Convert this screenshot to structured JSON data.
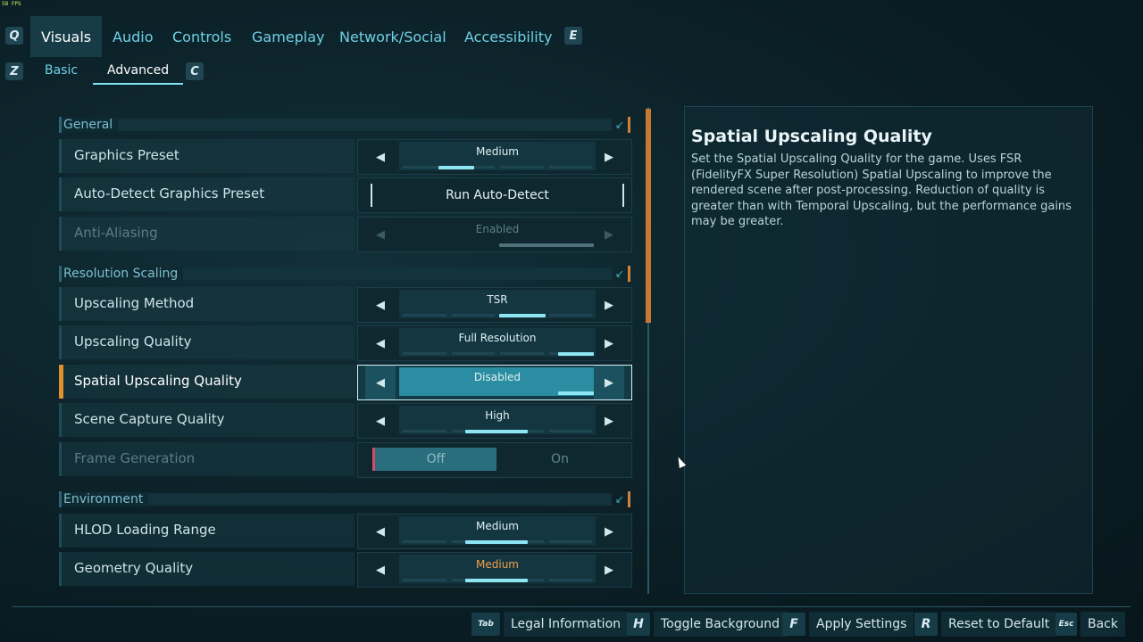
{
  "fps": "58 FPS",
  "nav": {
    "left_key": "Q",
    "right_key": "E",
    "tabs": [
      {
        "label": "Visuals",
        "active": true
      },
      {
        "label": "Audio"
      },
      {
        "label": "Controls"
      },
      {
        "label": "Gameplay"
      },
      {
        "label": "Network/Social"
      },
      {
        "label": "Accessibility"
      }
    ]
  },
  "subnav": {
    "left_key": "Z",
    "right_key": "C",
    "tabs": [
      {
        "label": "Basic"
      },
      {
        "label": "Advanced",
        "active": true
      }
    ]
  },
  "sections": {
    "general": "General",
    "resolution_scaling": "Resolution Scaling",
    "environment": "Environment"
  },
  "settings": {
    "graphics_preset": {
      "label": "Graphics Preset",
      "value": "Medium"
    },
    "auto_detect": {
      "label": "Auto-Detect Graphics Preset",
      "button": "Run Auto-Detect"
    },
    "anti_aliasing": {
      "label": "Anti-Aliasing",
      "value": "Enabled"
    },
    "upscaling_method": {
      "label": "Upscaling Method",
      "value": "TSR"
    },
    "upscaling_quality": {
      "label": "Upscaling Quality",
      "value": "Full Resolution"
    },
    "spatial_upscaling_quality": {
      "label": "Spatial Upscaling Quality",
      "value": "Disabled"
    },
    "scene_capture_quality": {
      "label": "Scene Capture Quality",
      "value": "High"
    },
    "frame_generation": {
      "label": "Frame Generation",
      "off": "Off",
      "on": "On"
    },
    "hlod_loading_range": {
      "label": "HLOD Loading Range",
      "value": "Medium"
    },
    "geometry_quality": {
      "label": "Geometry Quality",
      "value": "Medium"
    }
  },
  "description": {
    "title": "Spatial Upscaling Quality",
    "text": "Set the Spatial Upscaling Quality for the game. Uses FSR (FidelityFX Super Resolution) Spatial Upscaling to improve the rendered scene after post-processing. Reduction of quality is greater than with Temporal Upscaling, but the performance gains may be greater."
  },
  "footer": [
    {
      "key": "Tab",
      "label": "Legal Information"
    },
    {
      "key": "H",
      "label": "Toggle Background"
    },
    {
      "key": "F",
      "label": "Apply Settings"
    },
    {
      "key": "R",
      "label": "Reset to Default"
    },
    {
      "key": "Esc",
      "label": "Back"
    }
  ],
  "colors": {
    "accent": "#7fe3f5",
    "highlight": "#e0902f",
    "warning_value": "#f0a04a"
  }
}
